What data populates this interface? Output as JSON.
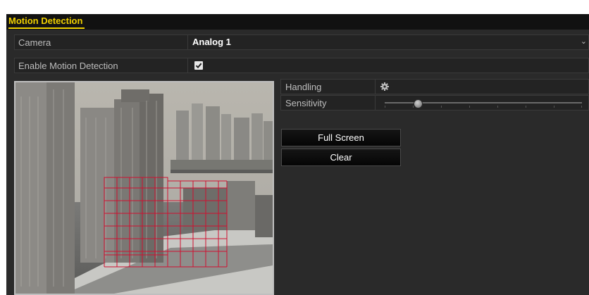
{
  "header": {
    "title": "Motion Detection"
  },
  "form": {
    "camera": {
      "label": "Camera",
      "value": "Analog 1"
    },
    "enable_motion": {
      "label": "Enable Motion Detection",
      "checked": true
    }
  },
  "settings": {
    "handling": {
      "label": "Handling",
      "icon": "gear-icon"
    },
    "sensitivity": {
      "label": "Sensitivity",
      "level": 0.17
    }
  },
  "buttons": {
    "full_screen": "Full Screen",
    "clear": "Clear"
  },
  "colors": {
    "title_accent": "#f0d000",
    "motion_grid": "#d01030"
  }
}
